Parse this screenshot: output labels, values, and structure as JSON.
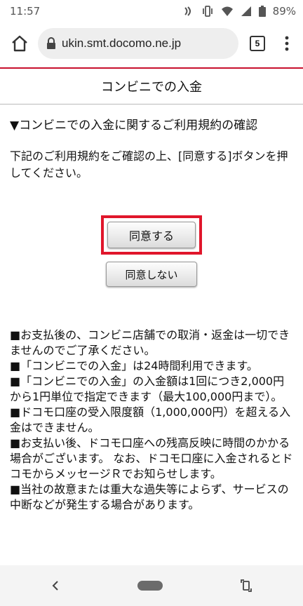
{
  "status_bar": {
    "time": "11:57",
    "battery": "89%"
  },
  "browser": {
    "url": "ukin.smt.docomo.ne.jp",
    "tab_count": "5"
  },
  "page": {
    "header_title": "コンビニでの入金",
    "section_title": "▼コンビニでの入金に関するご利用規約の確認",
    "instructions": "下記のご利用規約をご確認の上、[同意する]ボタンを押してください。",
    "agree_button": "同意する",
    "disagree_button": "同意しない",
    "terms": [
      "■お支払後の、コンビニ店舗での取消・返金は一切できませんのでご了承ください。",
      "■「コンビニでの入金」は24時間利用できます。",
      "■「コンビニでの入金」の入金額は1回につき2,000円から1円単位で指定できます（最大100,000円まで）。",
      "■ドコモ口座の受入限度額（1,000,000円）を超える入金はできません。",
      "■お支払い後、ドコモ口座への残高反映に時間のかかる場合がございます。 なお、ドコモ口座に入金されるとドコモからメッセージＲでお知らせします。",
      "■当社の故意または重大な過失等によらず、サービスの中断などが発生する場合があります。"
    ]
  },
  "colors": {
    "accent_red": "#e0162b",
    "brand_line": "#c8102e"
  }
}
